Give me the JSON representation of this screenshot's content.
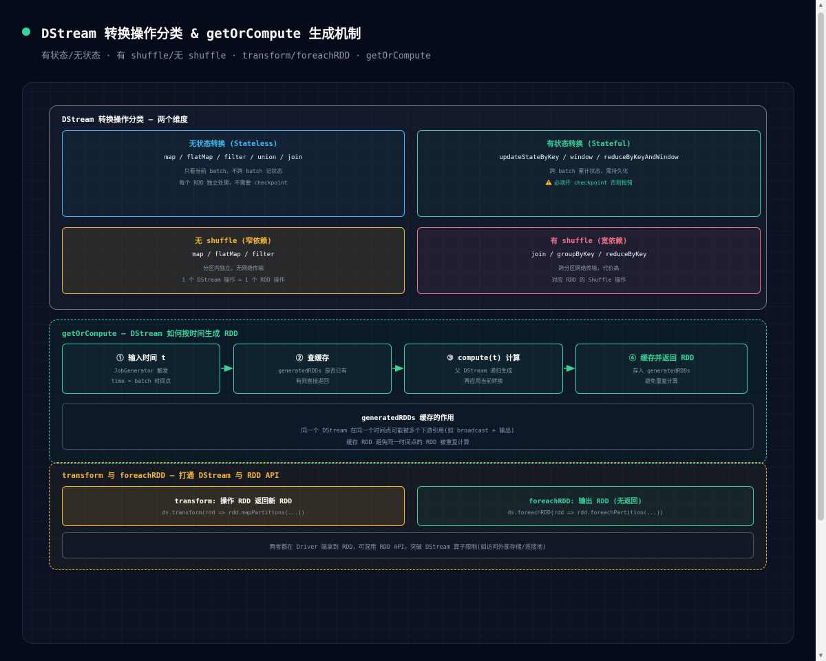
{
  "header": {
    "title": "DStream 转换操作分类 & getOrCompute 生成机制",
    "subtitle": "有状态/无状态 · 有 shuffle/无 shuffle · transform/foreachRDD · getOrCompute"
  },
  "classify": {
    "title": "DStream 转换操作分类 — 两个维度",
    "stateless": {
      "title": "无状态转换 (Stateless)",
      "ops": "map / flatMap / filter / union / join",
      "desc1": "只看当前 batch，不跨 batch 记状态",
      "desc2": "每个 RDD 独立处理，不需要 checkpoint"
    },
    "stateful": {
      "title": "有状态转换 (Stateful)",
      "ops": "updateStateByKey / window / reduceByKeyAndWindow",
      "desc1": "跨 batch 累计状态，需持久化",
      "warn_icon": "warning-icon",
      "desc2": "必须开 checkpoint 否则报错"
    },
    "narrow": {
      "title": "无 shuffle (窄依赖)",
      "ops": "map / flatMap / filter",
      "desc1": "分区内独立，无网络传输",
      "desc2": "1 个 DStream 操作 = 1 个 RDD 操作"
    },
    "wide": {
      "title": "有 shuffle (宽依赖)",
      "ops": "join / groupByKey / reduceByKey",
      "desc1": "跨分区网络传输，代价高",
      "desc2": "对应 RDD 的 Shuffle 操作"
    }
  },
  "getorcompute": {
    "title": "getOrCompute — DStream 如何按时间生成 RDD",
    "steps": [
      {
        "title": "① 输入时间 t",
        "line1": "JobGenerator 触发",
        "line2": "time = batch 时间点"
      },
      {
        "title": "② 查缓存",
        "line1": "generatedRDDs 是否已有",
        "line2": "有则直接返回"
      },
      {
        "title": "③ compute(t) 计算",
        "line1": "父 DStream 递归生成",
        "line2": "再应用当前转换"
      },
      {
        "title": "④ 缓存并返回 RDD",
        "line1": "存入 generatedRDDs",
        "line2": "避免重复计算"
      }
    ],
    "cache": {
      "title": "generatedRDDs 缓存的作用",
      "line1": "同一个 DStream 在同一个时间点可能被多个下游引用(如 broadcast + 输出)",
      "line2": "缓存 RDD 避免同一时间点的 RDD 被重复计算"
    }
  },
  "transform": {
    "title": "transform 与 foreachRDD — 打通 DStream 与 RDD API",
    "transform_box": {
      "title": "transform: 操作 RDD 返回新 RDD",
      "code": "ds.transform(rdd => rdd.mapPartitions(...))"
    },
    "foreach_box": {
      "title": "foreachRDD: 输出 RDD (无返回)",
      "code": "ds.foreachRDD(rdd => rdd.foreachPartition(...))"
    },
    "note": "两者都在 Driver 端拿到 RDD，可混用 RDD API，突破 DStream 算子限制(如访问外部存储/连接池)"
  },
  "colors": {
    "green": "#34d399",
    "cyan": "#38bdf8",
    "amber": "#f5b82e",
    "pink": "#f2708c",
    "slate": "#7b8699"
  }
}
